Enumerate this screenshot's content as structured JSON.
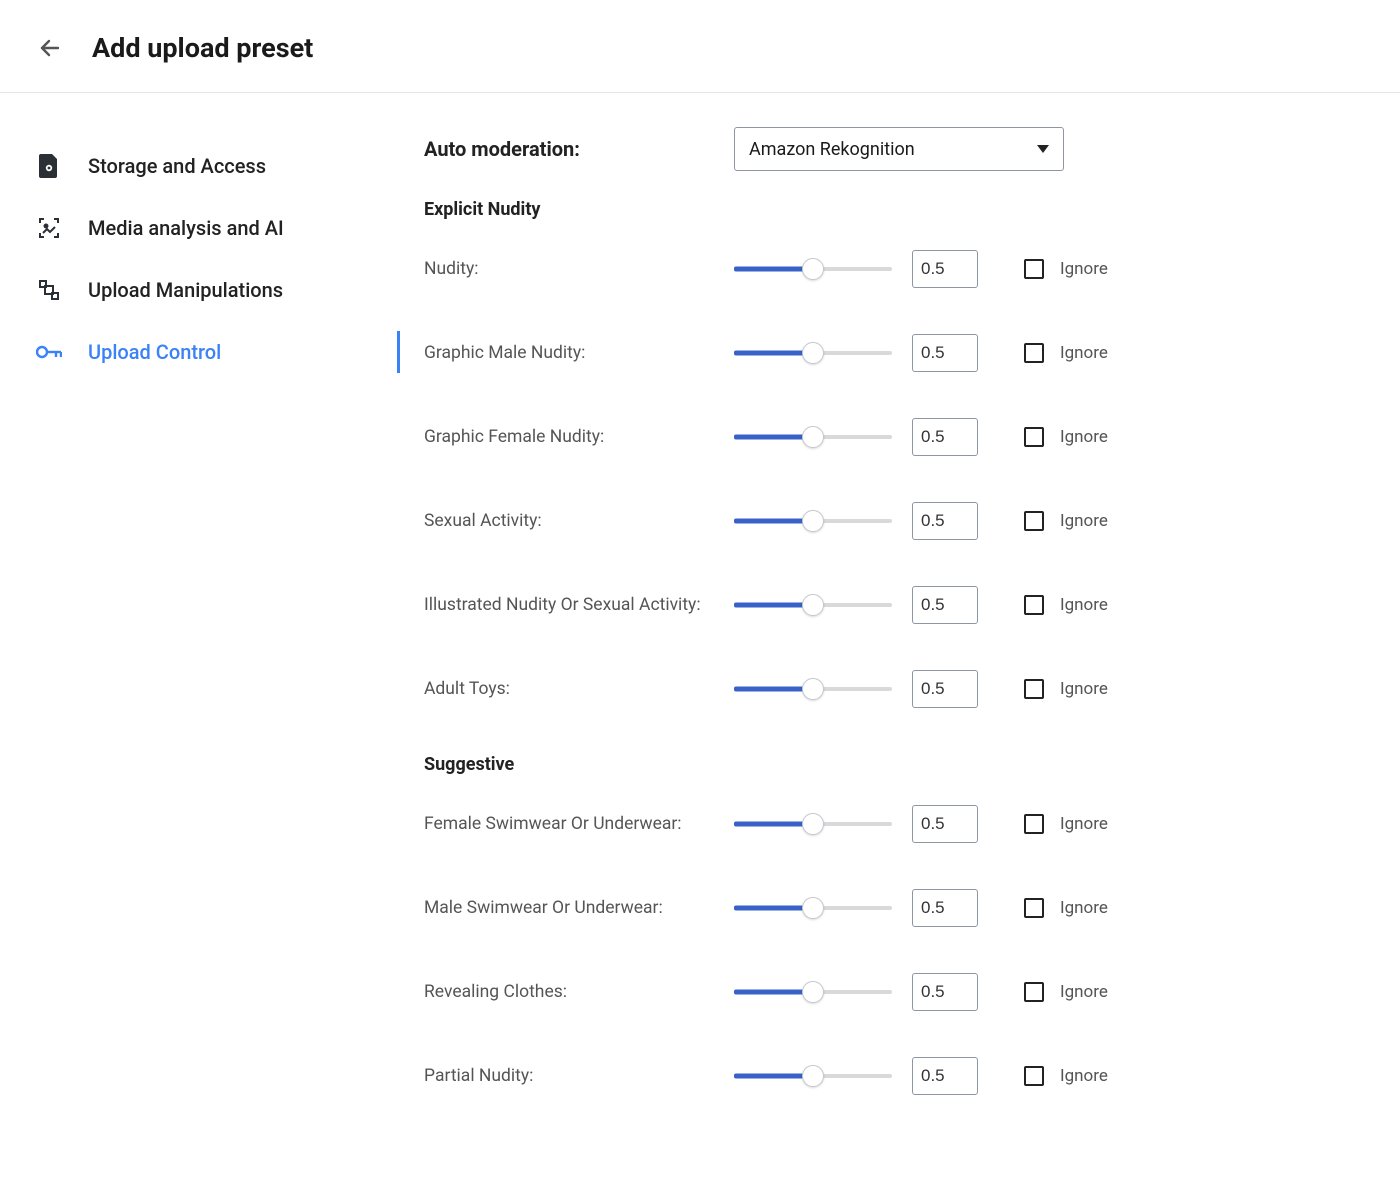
{
  "header": {
    "title": "Add upload preset"
  },
  "sidebar": {
    "items": [
      {
        "label": "Storage and Access",
        "icon": "file-gear-icon"
      },
      {
        "label": "Media analysis and AI",
        "icon": "image-analysis-icon"
      },
      {
        "label": "Upload Manipulations",
        "icon": "transform-icon"
      },
      {
        "label": "Upload Control",
        "icon": "key-icon"
      }
    ]
  },
  "main": {
    "auto_moderation_label": "Auto moderation:",
    "auto_moderation_value": "Amazon Rekognition",
    "ignore_label": "Ignore",
    "sections": [
      {
        "title": "Explicit Nudity",
        "rows": [
          {
            "label": "Nudity:",
            "value": "0.5"
          },
          {
            "label": "Graphic Male Nudity:",
            "value": "0.5"
          },
          {
            "label": "Graphic Female Nudity:",
            "value": "0.5"
          },
          {
            "label": "Sexual Activity:",
            "value": "0.5"
          },
          {
            "label": "Illustrated Nudity Or Sexual Activity:",
            "value": "0.5"
          },
          {
            "label": "Adult Toys:",
            "value": "0.5"
          }
        ]
      },
      {
        "title": "Suggestive",
        "rows": [
          {
            "label": "Female Swimwear Or Underwear:",
            "value": "0.5"
          },
          {
            "label": "Male Swimwear Or Underwear:",
            "value": "0.5"
          },
          {
            "label": "Revealing Clothes:",
            "value": "0.5"
          },
          {
            "label": "Partial Nudity:",
            "value": "0.5"
          }
        ]
      }
    ]
  }
}
